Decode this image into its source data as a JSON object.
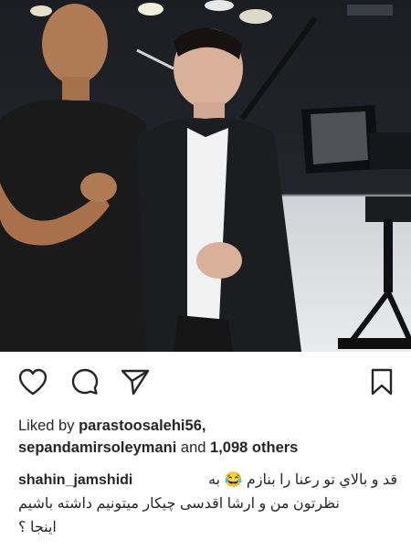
{
  "post": {
    "image_alt": "Two men posing in a TV studio",
    "actions": {
      "like_icon": "heart-icon",
      "comment_icon": "comment-icon",
      "share_icon": "send-icon",
      "save_icon": "bookmark-icon"
    },
    "likes": {
      "prefix": "Liked by",
      "user1": "parastoosalehi56,",
      "user2": "sepandamirsoleymani",
      "and": "and",
      "others": "1,098 others"
    },
    "caption": {
      "username": "shahin_jamshidi",
      "line1": "قد و بالاي تو رعنا را بنازم 😂 به",
      "line2": "نظرتون من و ارشا اقدسی چیکار میتونیم داشته باشیم",
      "line3": "اینجا ؟"
    }
  },
  "colors": {
    "text": "#262626",
    "background": "#ffffff"
  }
}
